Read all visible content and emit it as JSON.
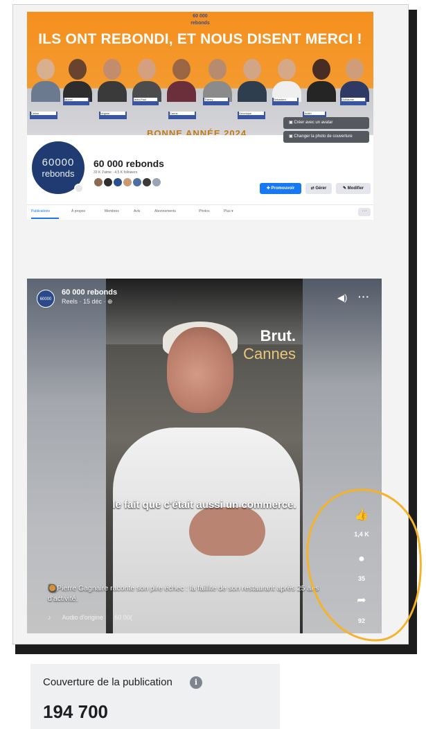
{
  "cover": {
    "logo_top": "60 000",
    "logo_bottom": "rebonds",
    "headline": "ILS ONT REBONDI, ET NOUS DISENT MERCI !",
    "tagline": "BONNE ANNÉE 2024",
    "edit_button": "Créer avec un avatar",
    "change_cover_button": "Changer la photo de couverture",
    "names": [
      "Michel",
      "Jean-Paul",
      "Thierry",
      "Sébastien",
      "Guillaume",
      "Céline",
      "Virginie",
      "Carine",
      "Véronique",
      "Judith"
    ]
  },
  "page": {
    "name": "60 000 rebonds",
    "stats": "33 K J'aime · 4,5 K followers",
    "avatar_line1": "60000",
    "avatar_line2": "rebonds",
    "promote_button": "Promouvoir",
    "manage_button": "Gérer",
    "edit_button": "Modifier"
  },
  "tabs": [
    {
      "label": "Publications",
      "active": true
    },
    {
      "label": "À propos"
    },
    {
      "label": "Membres"
    },
    {
      "label": "Avis"
    },
    {
      "label": "Abonnements"
    },
    {
      "label": "Photos"
    },
    {
      "label": "Plus ▾"
    }
  ],
  "reel": {
    "page_name": "60 000 rebonds",
    "meta": "Reels · 15 déc · ⊕",
    "brand_line1": "Brut.",
    "brand_line2": "Cannes",
    "subtitle": "le fait que c'était aussi un commerce.",
    "caption": "🥘Pierre Gagnaire raconte son pire échec : la faillite de son restaurant après 25 ans d'activité.",
    "audio_label": "Audio d'origine",
    "audio_owner": "60 00(",
    "likes": "1,4 K",
    "comments": "35",
    "shares": "92"
  },
  "metric": {
    "label": "Couverture de la publication",
    "info_glyph": "i",
    "value": "194 700"
  },
  "colors": {
    "facebook_blue": "#1877f2",
    "cover_orange": "#f5901e",
    "highlight_yellow": "#f4b32a"
  }
}
